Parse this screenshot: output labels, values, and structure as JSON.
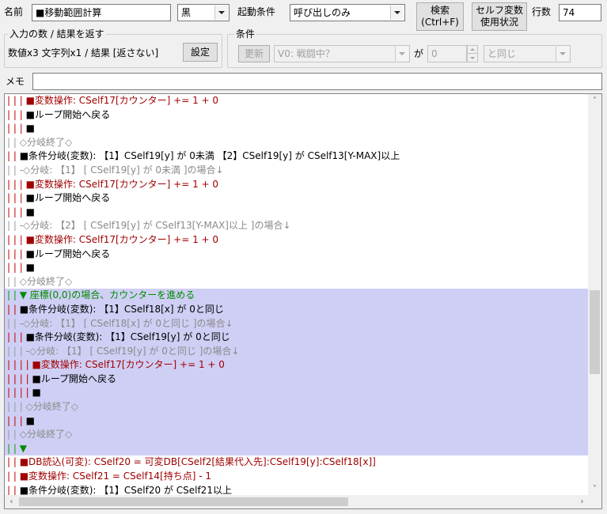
{
  "header": {
    "name_label": "名前",
    "name_value": "■移動範囲計算",
    "color_value": "黒",
    "trigger_label": "起動条件",
    "trigger_value": "呼び出しのみ",
    "search_line1": "検索",
    "search_line2": "(Ctrl+F)",
    "self_var_line1": "セルフ変数",
    "self_var_line2": "使用状況",
    "rows_label": "行数",
    "rows_value": "74"
  },
  "io_group": {
    "title": "入力の数 / 結果を返す",
    "summary": "数値x3 文字列x1 / 結果 [返さない]",
    "settings_button": "設定"
  },
  "condition_group": {
    "title": "条件",
    "update_button": "更新",
    "variable_value": "V0: 戦闘中？",
    "ga_label": "が",
    "number_value": "0",
    "compare_value": "と同じ"
  },
  "memo": {
    "label": "メモ",
    "value": ""
  },
  "listing": {
    "rows": [
      {
        "gutter": "| | | ",
        "gc": "red",
        "text": "■変数操作: CSelf17[カウンター] += 1 + 0",
        "tc": "red",
        "sel": false
      },
      {
        "gutter": "| | | ",
        "gc": "red",
        "text": "■ループ開始へ戻る",
        "tc": "black",
        "sel": false
      },
      {
        "gutter": "| | | ",
        "gc": "red",
        "text": "■",
        "tc": "black",
        "sel": false
      },
      {
        "gutter": "| | ",
        "gc": "gray",
        "text": "◇分岐終了◇",
        "tc": "gray",
        "sel": false
      },
      {
        "gutter": "| | ",
        "gc": "red",
        "text": "■条件分岐(変数): 【1】CSelf19[y] が 0未満 【2】CSelf19[y] が CSelf13[Y-MAX]以上",
        "tc": "black",
        "sel": false
      },
      {
        "gutter": "| | ",
        "gc": "gray",
        "text": "-◇分岐: 【1】 [ CSelf19[y] が 0未満 ]の場合↓",
        "tc": "gray",
        "sel": false
      },
      {
        "gutter": "| | | ",
        "gc": "red",
        "text": "■変数操作: CSelf17[カウンター] += 1 + 0",
        "tc": "red",
        "sel": false
      },
      {
        "gutter": "| | | ",
        "gc": "red",
        "text": "■ループ開始へ戻る",
        "tc": "black",
        "sel": false
      },
      {
        "gutter": "| | | ",
        "gc": "red",
        "text": "■",
        "tc": "black",
        "sel": false
      },
      {
        "gutter": "| | ",
        "gc": "gray",
        "text": "-◇分岐: 【2】 [ CSelf19[y] が CSelf13[Y-MAX]以上 ]の場合↓",
        "tc": "gray",
        "sel": false
      },
      {
        "gutter": "| | | ",
        "gc": "red",
        "text": "■変数操作: CSelf17[カウンター] += 1 + 0",
        "tc": "red",
        "sel": false
      },
      {
        "gutter": "| | | ",
        "gc": "red",
        "text": "■ループ開始へ戻る",
        "tc": "black",
        "sel": false
      },
      {
        "gutter": "| | | ",
        "gc": "red",
        "text": "■",
        "tc": "black",
        "sel": false
      },
      {
        "gutter": "| | ",
        "gc": "gray",
        "text": "◇分岐終了◇",
        "tc": "gray",
        "sel": false
      },
      {
        "gutter": "| | ",
        "gc": "green",
        "text": "▼ 座標(0,0)の場合、カウンターを進める",
        "tc": "green",
        "sel": true
      },
      {
        "gutter": "| | ",
        "gc": "red",
        "text": "■条件分岐(変数): 【1】CSelf18[x] が 0と同じ",
        "tc": "black",
        "sel": true
      },
      {
        "gutter": "| | ",
        "gc": "gray",
        "text": "-◇分岐: 【1】 [ CSelf18[x] が 0と同じ ]の場合↓",
        "tc": "gray",
        "sel": true
      },
      {
        "gutter": "| | | ",
        "gc": "red",
        "text": "■条件分岐(変数): 【1】CSelf19[y] が 0と同じ",
        "tc": "black",
        "sel": true
      },
      {
        "gutter": "| | | ",
        "gc": "gray",
        "text": "-◇分岐: 【1】 [ CSelf19[y] が 0と同じ ]の場合↓",
        "tc": "gray",
        "sel": true
      },
      {
        "gutter": "| | | | ",
        "gc": "red",
        "text": "■変数操作: CSelf17[カウンター] += 1 + 0",
        "tc": "red",
        "sel": true
      },
      {
        "gutter": "| | | | ",
        "gc": "red",
        "text": "■ループ開始へ戻る",
        "tc": "black",
        "sel": true
      },
      {
        "gutter": "| | | | ",
        "gc": "red",
        "text": "■",
        "tc": "black",
        "sel": true
      },
      {
        "gutter": "| | | ",
        "gc": "gray",
        "text": "◇分岐終了◇",
        "tc": "gray",
        "sel": true
      },
      {
        "gutter": "| | | ",
        "gc": "red",
        "text": "■",
        "tc": "black",
        "sel": true
      },
      {
        "gutter": "| | ",
        "gc": "gray",
        "text": "◇分岐終了◇",
        "tc": "gray",
        "sel": true
      },
      {
        "gutter": "| | ",
        "gc": "green",
        "text": "▼",
        "tc": "green",
        "sel": true
      },
      {
        "gutter": "| | ",
        "gc": "red",
        "text": "■DB読込(可変): CSelf20 = 可変DB[CSelf2[結果代入先]:CSelf19[y]:CSelf18[x]]",
        "tc": "red",
        "sel": false
      },
      {
        "gutter": "| | ",
        "gc": "red",
        "text": "■変数操作: CSelf21 = CSelf14[持ち点] - 1",
        "tc": "red",
        "sel": false
      },
      {
        "gutter": "| | ",
        "gc": "red",
        "text": "■条件分岐(変数): 【1】CSelf20 が CSelf21以上",
        "tc": "black",
        "sel": false
      }
    ]
  }
}
